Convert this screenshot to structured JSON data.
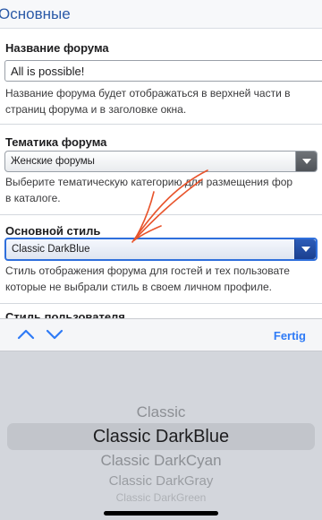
{
  "header": {
    "title": "Основные"
  },
  "forum_name": {
    "label": "Название форума",
    "value": "All is possible!",
    "help_line1": "Название форума будет отображаться в верхней части в",
    "help_line2": "страниц форума и в заголовке окна."
  },
  "forum_topic": {
    "label": "Тематика форума",
    "selected": "Женские форумы",
    "help_line1": "Выберите тематическую категорию для размещения фор",
    "help_line2": "в каталоге."
  },
  "main_style": {
    "label": "Основной стиль",
    "selected": "Classic DarkBlue",
    "help_line1": "Стиль отображения форума для гостей и тех пользовате",
    "help_line2": "которые не выбрали стиль в своем личном профиле."
  },
  "user_style": {
    "label": "Стиль пользователя"
  },
  "toolbar": {
    "prev_icon": "chevron-up-icon",
    "next_icon": "chevron-down-icon",
    "done_label": "Fertig",
    "accent": "#2f7bf6"
  },
  "picker": {
    "options": [
      "Classic",
      "Classic DarkBlue",
      "Classic DarkCyan",
      "Classic DarkGray",
      "Classic DarkGreen"
    ],
    "selected": "Classic DarkBlue"
  },
  "colors": {
    "header_text": "#2b5aa8",
    "annotation": "#e8542c",
    "focus_ring": "#2f6fdc"
  }
}
